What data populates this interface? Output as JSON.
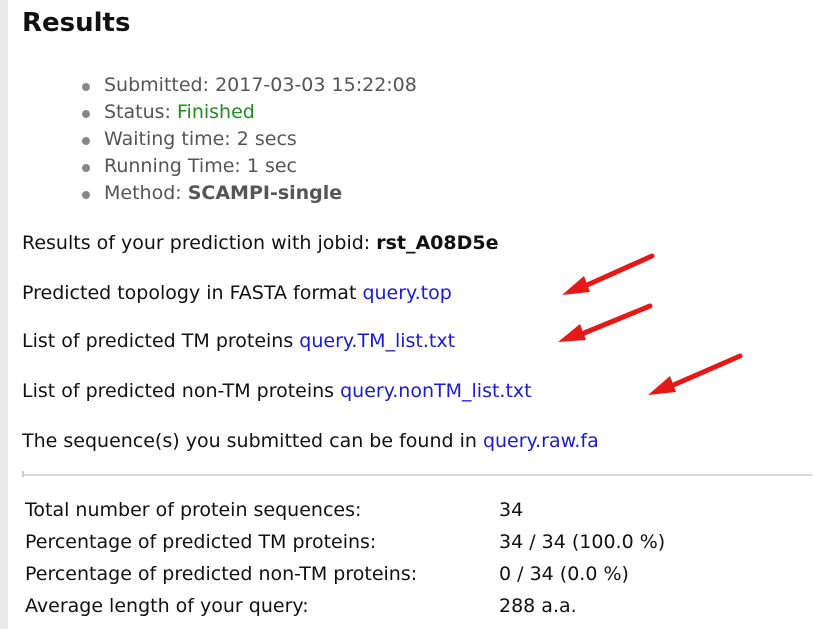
{
  "results": {
    "title": "Results",
    "meta": {
      "submitted_label": "Submitted:",
      "submitted_value": "2017-03-03 15:22:08",
      "status_label": "Status:",
      "status_value": "Finished",
      "waiting_label": "Waiting time:",
      "waiting_value": "2 secs",
      "running_label": "Running Time:",
      "running_value": "1 sec",
      "method_label": "Method:",
      "method_value": "SCAMPI-single"
    },
    "jobid_text": "Results of your prediction with jobid: ",
    "jobid_value": "rst_A08D5e",
    "links": {
      "topology_text": "Predicted topology in FASTA format ",
      "topology_link": "query.top",
      "tm_list_text": "List of predicted TM proteins ",
      "tm_list_link": "query.TM_list.txt",
      "nontm_list_text": "List of predicted non-TM proteins ",
      "nontm_list_link": "query.nonTM_list.txt",
      "raw_text": "The sequence(s) you submitted can be found in ",
      "raw_link": "query.raw.fa"
    },
    "stats": [
      {
        "label": "Total number of protein sequences:",
        "value": "34"
      },
      {
        "label": "Percentage of predicted TM proteins:",
        "value": "34 / 34 (100.0 %)"
      },
      {
        "label": "Percentage of predicted non-TM proteins:",
        "value": "0 / 34 (0.0 %)"
      },
      {
        "label": "Average length of your query:",
        "value": "288 a.a."
      }
    ]
  },
  "colors": {
    "link": "#1a1ad6",
    "finished": "#228b22",
    "arrow": "#e61919"
  }
}
